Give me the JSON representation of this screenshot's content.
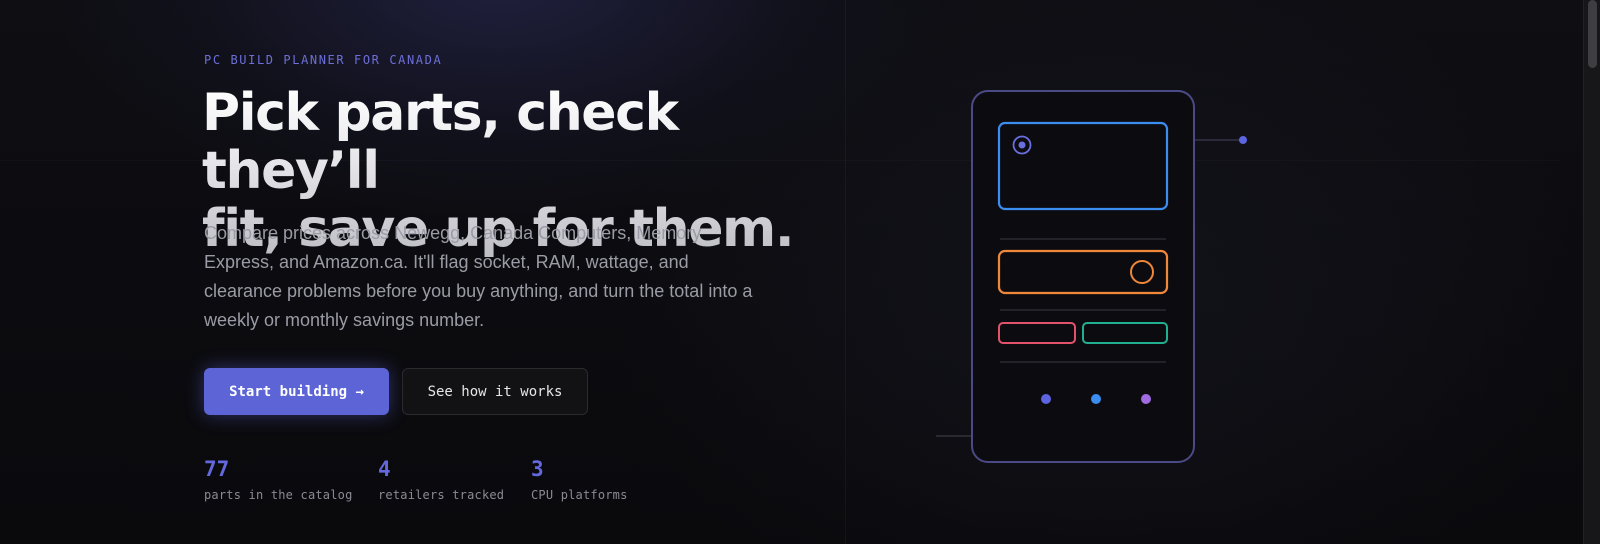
{
  "hero": {
    "eyebrow": "PC BUILD PLANNER FOR CANADA",
    "headline_line1": "Pick parts, check they’ll",
    "headline_line2": "fit, save up for them.",
    "lede": "Compare prices across Newegg, Canada Computers, Memory Express, and Amazon.ca. It'll flag socket, RAM, wattage, and clearance problems before you buy anything, and turn the total into a weekly or monthly savings number.",
    "primary_button": "Start building →",
    "secondary_button": "See how it works"
  },
  "stats": [
    {
      "value": "77",
      "label": "parts in the catalog"
    },
    {
      "value": "4",
      "label": "retailers tracked"
    },
    {
      "value": "3",
      "label": "CPU platforms"
    }
  ],
  "colors": {
    "accent": "#5d64d6",
    "case_outline": "#4b4a86",
    "gpu_panel": "#3b8df0",
    "psu_panel": "#f0883b",
    "ram_left": "#e2536b",
    "ram_right": "#21b08f",
    "led_1": "#5c64e0",
    "led_2": "#3b8df0",
    "led_3": "#a06be0"
  },
  "icons": {
    "pc_case": "pc-case-illustration",
    "fan": "fan-icon"
  }
}
